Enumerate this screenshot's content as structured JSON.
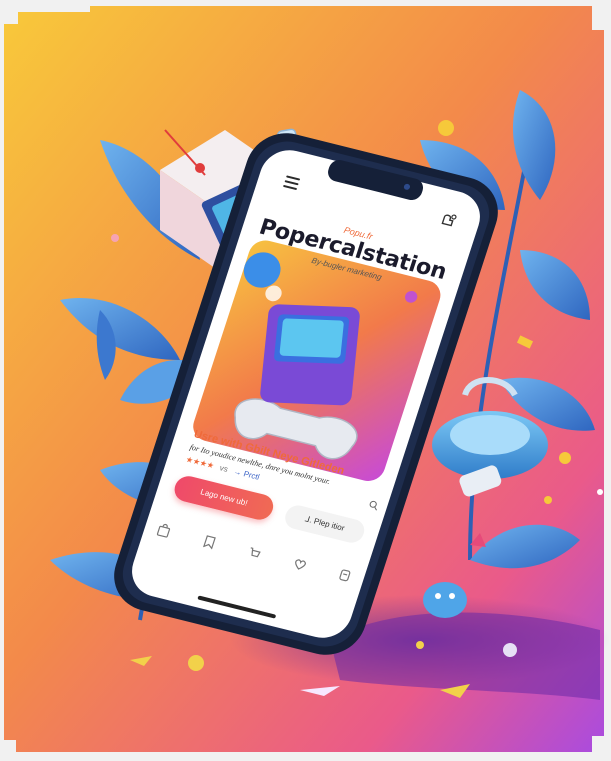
{
  "app": {
    "eyebrow": "Popu.fr",
    "title": "Popercalstation",
    "subtitle": "By-bugler marketing"
  },
  "card": {
    "title": "Usre with Gbilt Neye Gitleden",
    "description": "for Ito youdice newlthe, dnre you molnt your.",
    "rating_stars": "★★★★",
    "rating_meta": "vs",
    "rating_tag": "→ Prctl"
  },
  "actions": {
    "primary_label": "Lago new ub!",
    "secondary_label": "⅃. Plep itior"
  },
  "icons": [
    "hamburger-icon",
    "profile-icon",
    "search-icon",
    "bag-icon",
    "bookmark-icon",
    "cart-icon",
    "heart-icon",
    "settings-icon"
  ],
  "colors": {
    "bg_top": "#f6c23a",
    "bg_mid": "#f08a4a",
    "bg_bottom": "#b64bd8",
    "accent": "#ef6a3a",
    "leaf": "#4d8fd6",
    "phone_frame": "#1a2440"
  }
}
